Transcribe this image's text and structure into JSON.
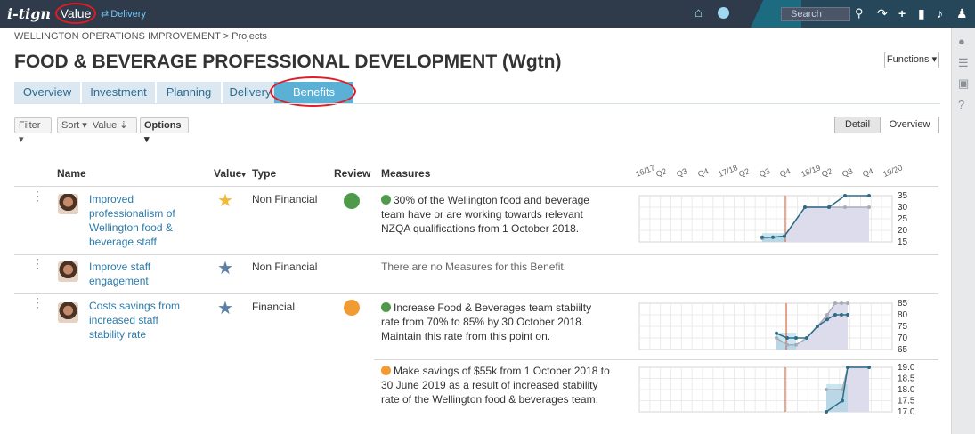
{
  "topbar": {
    "logo": "i-tign",
    "value_label": "Value",
    "delivery_label": "Delivery",
    "search_placeholder": "Search",
    "icons": [
      "home-icon",
      "globe-icon",
      "search-icon",
      "share-icon",
      "plus-icon",
      "bookmark-icon",
      "bell-icon",
      "user-icon"
    ]
  },
  "rail": {
    "icons": [
      "comment-icon",
      "list-icon",
      "lock-icon",
      "help-icon"
    ]
  },
  "breadcrumb": "WELLINGTON OPERATIONS IMPROVEMENT > Projects",
  "title": "FOOD & BEVERAGE PROFESSIONAL DEVELOPMENT (Wgtn)",
  "functions_label": "Functions",
  "tabs": [
    {
      "label": "Overview"
    },
    {
      "label": "Investment"
    },
    {
      "label": "Planning"
    },
    {
      "label": "Delivery"
    },
    {
      "label": "Benefits"
    }
  ],
  "toolbar": {
    "filter": "Filter",
    "sort": "Sort",
    "sort_value": "Value",
    "options": "Options",
    "detail": "Detail",
    "overview": "Overview"
  },
  "columns": {
    "name": "Name",
    "value": "Value",
    "type": "Type",
    "review": "Review",
    "measures": "Measures"
  },
  "periods": [
    "16/17",
    "Q2",
    "Q3",
    "Q4",
    "17/18",
    "Q2",
    "Q3",
    "Q4",
    "18/19",
    "Q2",
    "Q3",
    "Q4",
    "19/20"
  ],
  "colors": {
    "green": "#4e9a4a",
    "orange": "#f29b33",
    "star_gold": "#f0b93a",
    "star_blue": "#5b7fa6",
    "link": "#2c7aa8",
    "accent": "#5bb0d6"
  },
  "benefits": [
    {
      "name": "Improved professionalism of Wellington food & beverage staff",
      "star": "gold",
      "type": "Non Financial",
      "review": "green",
      "measures": [
        {
          "status": "green",
          "text": "30% of the Wellington food and beverage team have or are working towards relevant NZQA qualifications from 1 October 2018."
        }
      ]
    },
    {
      "name": "Improve staff engagement",
      "star": "blue",
      "type": "Non Financial",
      "review": "",
      "no_measures": "There are no Measures for this Benefit."
    },
    {
      "name": "Costs savings from increased staff stability rate",
      "star": "blue",
      "type": "Financial",
      "review": "orange",
      "measures": [
        {
          "status": "green",
          "text": "Increase Food & Beverages team stabiilty rate from 70% to 85% by 30 October 2018. Maintain this rate from this point on."
        },
        {
          "status": "orange",
          "text": "Make savings of $55k from 1 October 2018 to 30 June 2019 as a result of increased stability rate of the Wellington food & beverages team."
        }
      ]
    }
  ],
  "chart_data": [
    {
      "type": "line",
      "y_ticks": [
        "35",
        "30",
        "25",
        "20",
        "15"
      ],
      "ylim": [
        15,
        35
      ],
      "series": [
        {
          "values": [
            16.5,
            17,
            17.5,
            30,
            30,
            30,
            30
          ]
        },
        {
          "values": [
            17,
            17,
            17.5,
            30,
            30,
            35,
            35
          ]
        }
      ]
    },
    {
      "type": "line",
      "y_ticks": [
        "85",
        "80",
        "75",
        "70",
        "65"
      ],
      "ylim": [
        65,
        85
      ],
      "series": [
        {
          "values": [
            70,
            67,
            67,
            70,
            75,
            80,
            85,
            85,
            85
          ]
        },
        {
          "values": [
            72,
            70,
            70,
            70,
            75,
            78,
            80,
            80,
            80
          ]
        }
      ]
    },
    {
      "type": "line",
      "y_ticks": [
        "19.0",
        "18.5",
        "18.0",
        "17.5",
        "17.0"
      ],
      "ylim": [
        17.0,
        19.0
      ],
      "series": [
        {
          "values": [
            18.0,
            18.0,
            19.0,
            19.0
          ]
        },
        {
          "values": [
            17.0,
            17.5,
            19.0,
            19.0
          ]
        }
      ]
    }
  ]
}
